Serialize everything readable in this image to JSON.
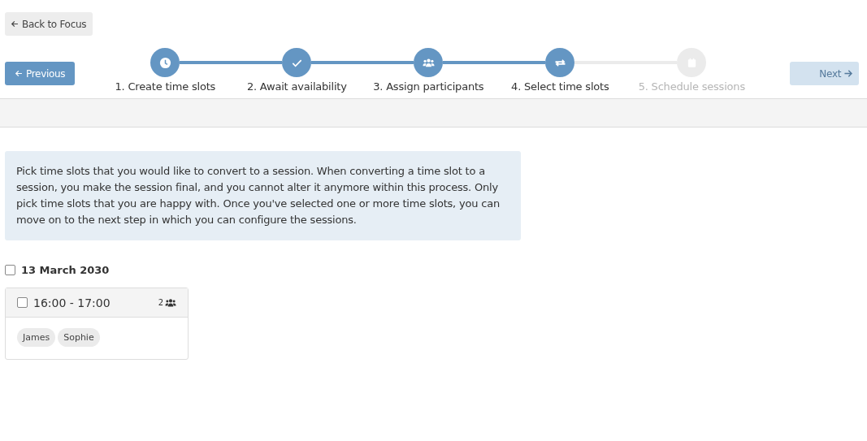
{
  "back_button": {
    "label": "Back to Focus"
  },
  "previous_button": {
    "label": "Previous",
    "disabled": false
  },
  "next_button": {
    "label": "Next",
    "disabled": true
  },
  "steps": [
    {
      "label": "1. Create time slots",
      "kind": "clock",
      "reached": true
    },
    {
      "label": "2. Await availability",
      "kind": "check",
      "reached": true
    },
    {
      "label": "3. Assign participants",
      "kind": "users",
      "reached": true
    },
    {
      "label": "4. Select time slots",
      "kind": "repeat",
      "reached": true
    },
    {
      "label": "5. Schedule sessions",
      "kind": "calendar",
      "reached": false
    }
  ],
  "info": "Pick time slots that you would like to convert to a session. When converting a time slot to a session, you make the session final, and you cannot alter it anymore within this process. Only pick time slots that you are happy with. Once you've selected one or more time slots, you can move on to the next step in which you can configure the sessions.",
  "days": [
    {
      "date": "13 March 2030",
      "checked": false,
      "slots": [
        {
          "time": "16:00 - 17:00",
          "checked": false,
          "count": "2",
          "participants": [
            "James",
            "Sophie"
          ]
        }
      ]
    }
  ]
}
